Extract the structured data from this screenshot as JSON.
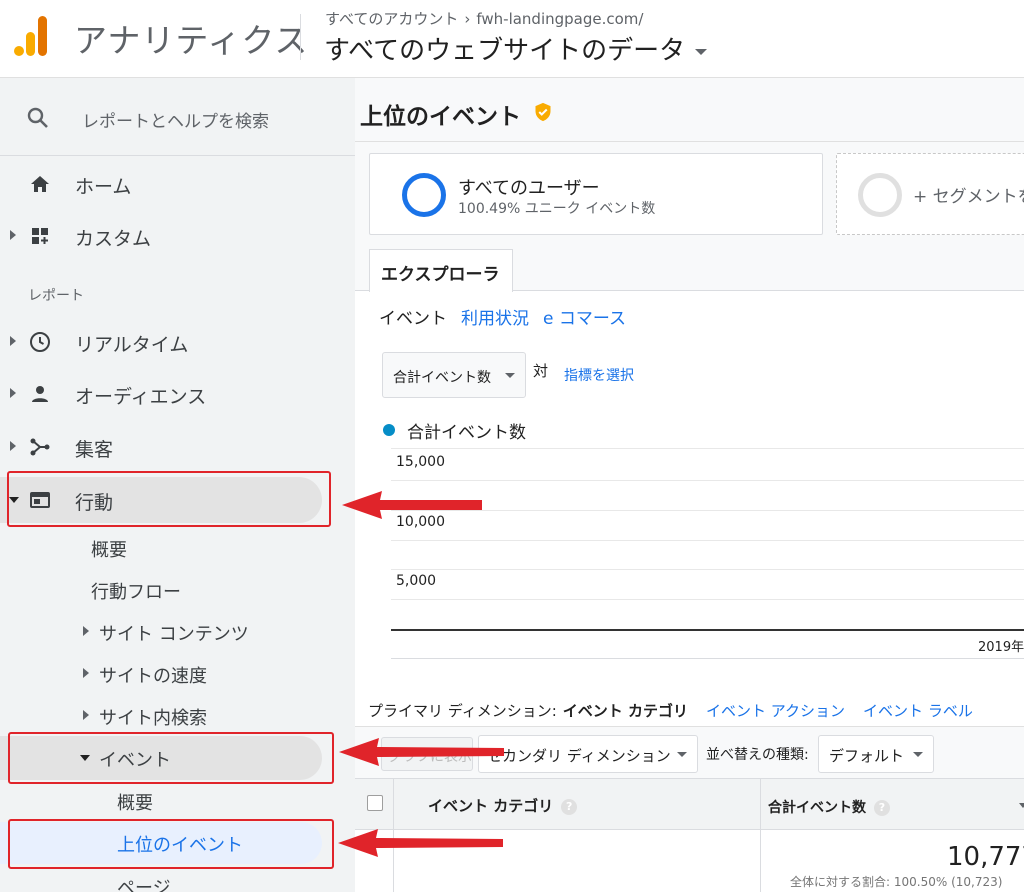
{
  "header": {
    "app_title": "アナリティクス",
    "breadcrumb_account": "すべてのアカウント",
    "breadcrumb_separator": "›",
    "breadcrumb_property": "fwh-landingpage.com/",
    "view_title": "すべてのウェブサイトのデータ"
  },
  "sidebar": {
    "search_placeholder": "レポートとヘルプを検索",
    "home": "ホーム",
    "custom": "カスタム",
    "section_reports": "レポート",
    "realtime": "リアルタイム",
    "audience": "オーディエンス",
    "acquisition": "集客",
    "behavior": "行動",
    "behavior_items": {
      "overview": "概要",
      "flow": "行動フロー",
      "site_content": "サイト コンテンツ",
      "site_speed": "サイトの速度",
      "site_search": "サイト内検索",
      "events": "イベント"
    },
    "event_items": {
      "overview": "概要",
      "top_events": "上位のイベント",
      "pages": "ページ"
    }
  },
  "main": {
    "report_title": "上位のイベント",
    "segment": {
      "name": "すべてのユーザー",
      "sub": "100.49% ユニーク イベント数",
      "add_label": "+ セグメントを"
    },
    "tab_explorer": "エクスプローラ",
    "subtabs": {
      "events": "イベント",
      "usage": "利用状況",
      "ecommerce": "e コマース"
    },
    "metric_select": "合計イベント数",
    "vs_label": "対",
    "choose_metric": "指標を選択",
    "legend": "合計イベント数",
    "dimensions": {
      "label": "プライマリ ディメンション:",
      "active": "イベント カテゴリ",
      "action": "イベント アクション",
      "label_link": "イベント ラベル"
    },
    "toolbar": {
      "plot_rows": "グラフに表示",
      "secondary_dim": "セカンダリ ディメンション",
      "sort_label": "並べ替えの種類:",
      "sort_value": "デフォルト"
    },
    "table": {
      "col_category": "イベント カテゴリ",
      "col_total": "合計イベント数",
      "help_glyph": "?",
      "total_value": "10,777",
      "total_sub": "全体に対する割合: 100.50% (10,723)"
    }
  },
  "chart_data": {
    "type": "line",
    "title": "",
    "series": [
      {
        "name": "合計イベント数",
        "values": []
      }
    ],
    "yticks": [
      "15,000",
      "10,000",
      "5,000"
    ],
    "ylim": [
      0,
      15000
    ],
    "x_label_visible": "2019年",
    "colors": {
      "series": "#058dc7"
    }
  },
  "colors": {
    "accent": "#1a73e8",
    "highlight_box": "#e0242a",
    "selected_bg": "#e8f0fe"
  }
}
